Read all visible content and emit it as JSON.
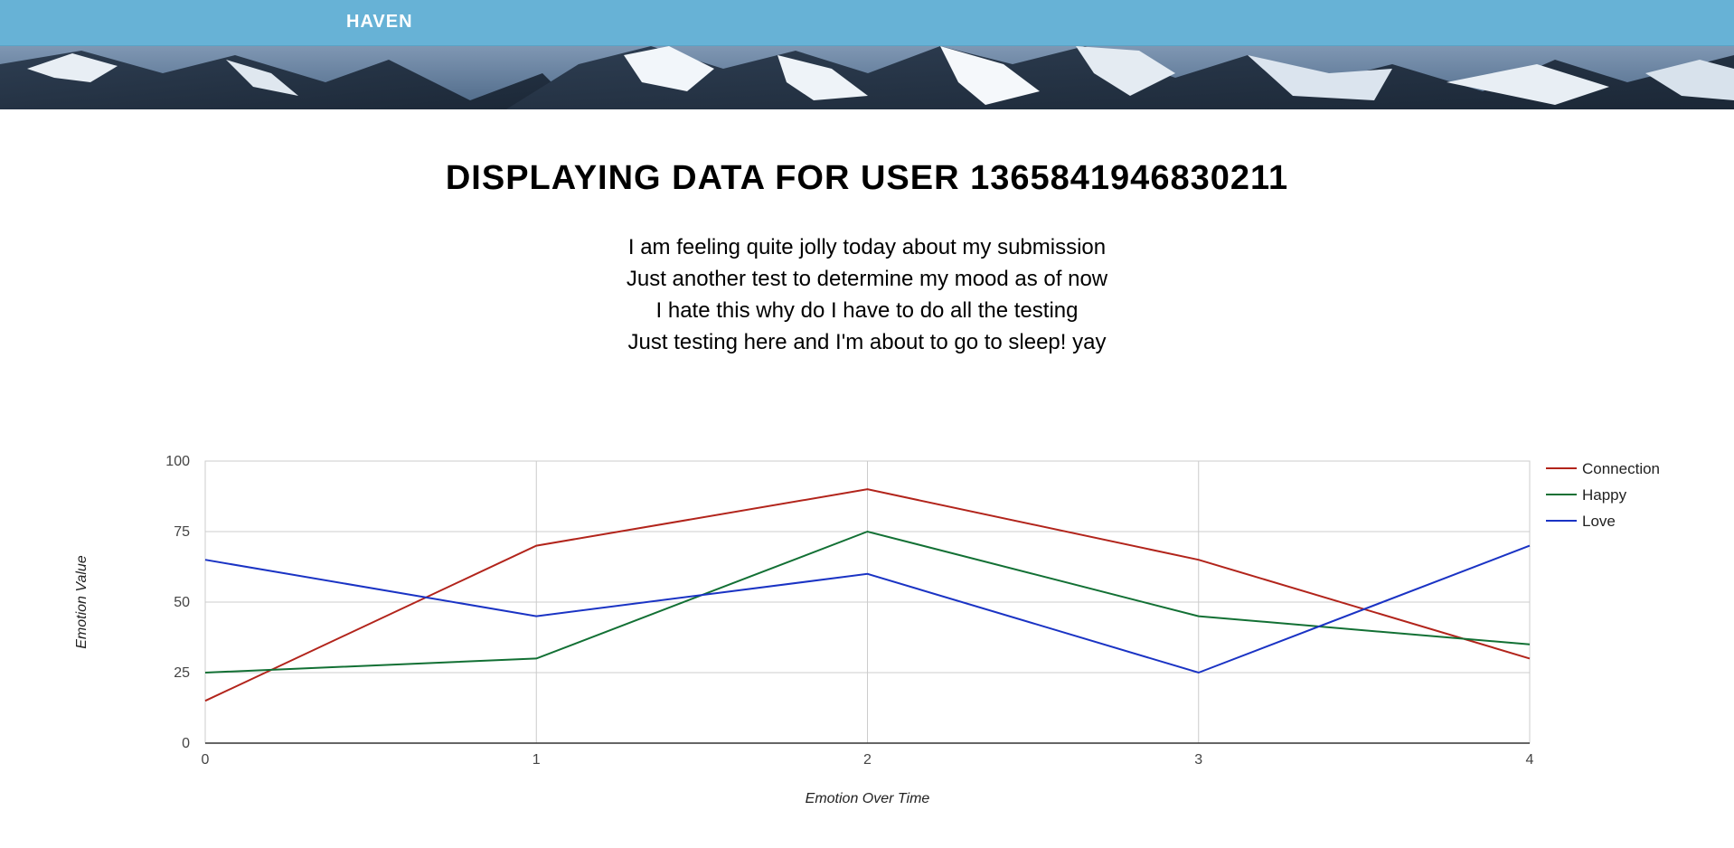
{
  "header": {
    "brand": "HAVEN",
    "background_color": "#67b2d6"
  },
  "main": {
    "title": "DISPLAYING DATA FOR USER 1365841946830211",
    "entries": [
      "I am feeling quite jolly today about my submission",
      "Just another test to determine my mood as of now",
      "I hate this why do I have to do all the testing",
      "Just testing here and I'm about to go to sleep! yay"
    ]
  },
  "chart_data": {
    "type": "line",
    "title": "",
    "xlabel": "Emotion Over Time",
    "ylabel": "Emotion Value",
    "x": [
      0,
      1,
      2,
      3,
      4
    ],
    "xlim": [
      0,
      4
    ],
    "ylim": [
      0,
      100
    ],
    "yticks": [
      0,
      25,
      50,
      75,
      100
    ],
    "xticks": [
      0,
      1,
      2,
      3,
      4
    ],
    "grid": true,
    "legend_position": "right",
    "series": [
      {
        "name": "Connection",
        "color": "#b2241b",
        "values": [
          15,
          70,
          90,
          65,
          30
        ]
      },
      {
        "name": "Happy",
        "color": "#127034",
        "values": [
          25,
          30,
          75,
          45,
          35
        ]
      },
      {
        "name": "Love",
        "color": "#1a33c4",
        "values": [
          65,
          45,
          60,
          25,
          70
        ]
      }
    ]
  }
}
